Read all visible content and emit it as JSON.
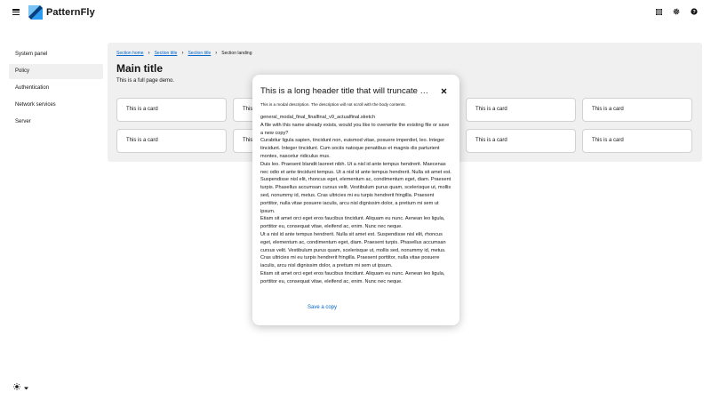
{
  "header": {
    "brand": "PatternFly"
  },
  "sidebar": {
    "items": [
      {
        "label": "System panel"
      },
      {
        "label": "Policy"
      },
      {
        "label": "Authentication"
      },
      {
        "label": "Network services"
      },
      {
        "label": "Server"
      }
    ]
  },
  "main": {
    "breadcrumb": [
      "Section home",
      "Section title",
      "Section title",
      "Section landing"
    ],
    "title": "Main title",
    "description": "This is a full page demo.",
    "card_label": "This is a card"
  },
  "modal": {
    "title": "This is a long header title that will truncate because modal titles should be very short. Use the modal description for longer text.",
    "description": "This is a modal description. The description will not scroll with the body contents.",
    "body": [
      "general_modal_final_finalfinal_v9_actualfinal.sketch",
      "A file with this name already exists, would you like to overwrite the existing file or save a new copy?",
      "Curabitur ligula sapien, tincidunt non, euismod vitae, posuere imperdiet, leo. Integer tincidunt. Integer tincidunt. Cum sociis natoque penatibus et magnis dis parturient montes, nascetur ridiculus mus.",
      "Duis leo. Praesent blandit laoreet nibh. Ut a nisl id ante tempus hendrerit. Maecenas nec odio et ante tincidunt tempus. Ut a nisl id ante tempus hendrerit. Nulla sit amet est. Suspendisse nisl elit, rhoncus eget, elementum ac, condimentum eget, diam. Praesent turpis. Phasellus accumsan cursus velit. Vestibulum purus quam, scelerisque ut, mollis sed, nonummy id, metus. Cras ultricies mi eu turpis hendrerit fringilla. Praesent porttitor, nulla vitae posuere iaculis, arcu nisl dignissim dolor, a pretium mi sem ut ipsum.",
      "Etiam sit amet orci eget eros faucibus tincidunt. Aliquam eu nunc. Aenean leo ligula, porttitor eu, consequat vitae, eleifend ac, enim. Nunc nec neque.",
      "Ut a nisl id ante tempus hendrerit. Nulla sit amet est. Suspendisse nisl elit, rhoncus eget, elementum ac, condimentum eget, diam. Praesent turpis. Phasellus accumsan cursus velit. Vestibulum purus quam, scelerisque ut, mollis sed, nonummy id, metus. Cras ultricies mi eu turpis hendrerit fringilla. Praesent porttitor, nulla vitae posuere iaculis, arcu nisl dignissim dolor, a pretium mi sem ut ipsum.",
      "Etiam sit amet orci eget eros faucibus tincidunt. Aliquam eu nunc. Aenean leo ligula, porttitor eu, consequat vitae, eleifend ac, enim. Nunc nec neque."
    ],
    "action_label": "Save a copy"
  },
  "icons": {
    "menu": "hamburger-icon",
    "apps": "grid-icon",
    "settings": "gear-icon",
    "help": "question-circle-icon",
    "close": "close-icon",
    "theme": "sun-icon",
    "caret": "caret-down-icon"
  },
  "colors": {
    "link": "#0066cc",
    "main_bg": "#f0f0f0",
    "brand_blue": "#2b9af3"
  }
}
